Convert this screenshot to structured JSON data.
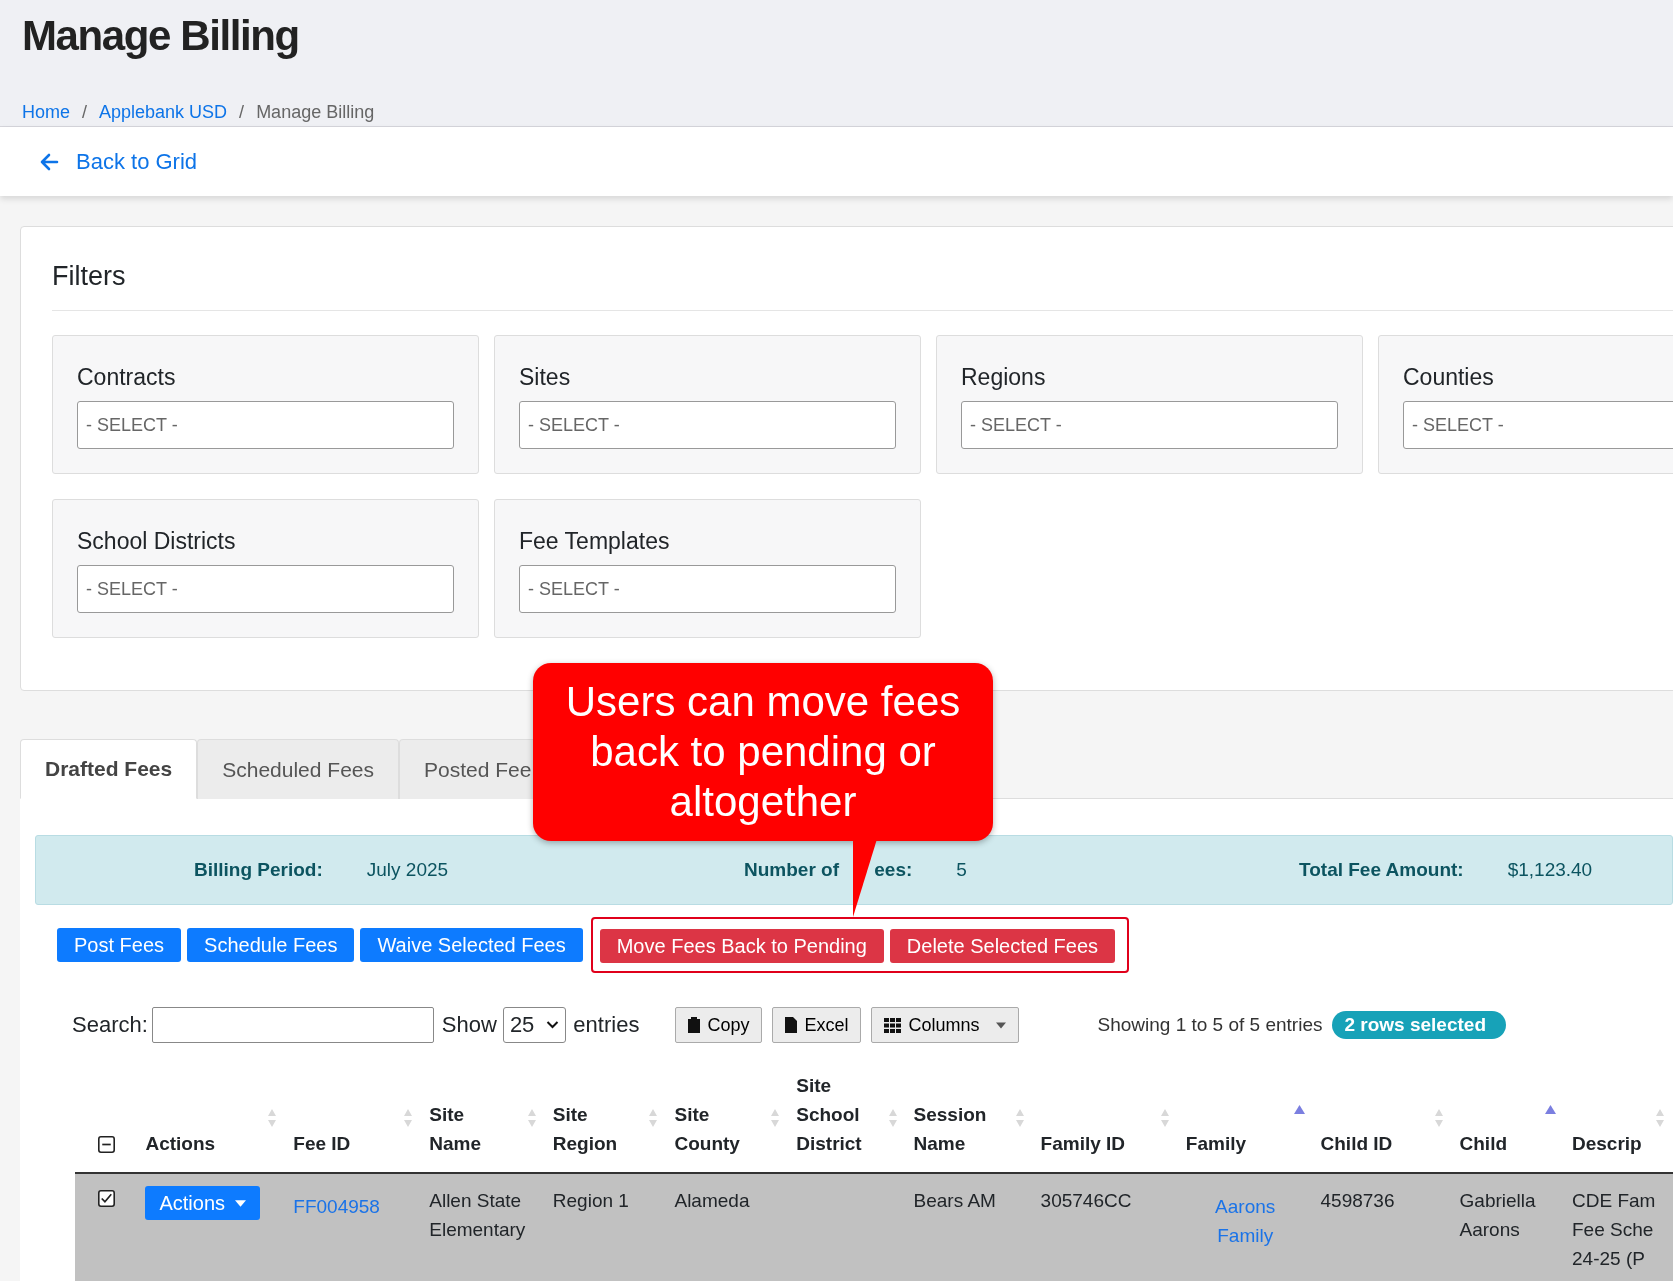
{
  "page": {
    "title": "Manage Billing"
  },
  "breadcrumbs": [
    {
      "label": "Home",
      "link": true
    },
    {
      "separator": "/",
      "label": "Applebank USD",
      "link": true
    },
    {
      "separator": "/",
      "label": "Manage Billing",
      "link": false
    }
  ],
  "back_link": "Back to Grid",
  "filters": {
    "title": "Filters",
    "items": [
      {
        "label": "Contracts",
        "placeholder": "- SELECT -"
      },
      {
        "label": "Sites",
        "placeholder": "- SELECT -"
      },
      {
        "label": "Regions",
        "placeholder": "- SELECT -"
      },
      {
        "label": "Counties",
        "placeholder": "- SELECT -"
      },
      {
        "label": "School Districts",
        "placeholder": "- SELECT -"
      },
      {
        "label": "Fee Templates",
        "placeholder": "- SELECT -"
      }
    ]
  },
  "tabs": [
    {
      "label": "Drafted Fees",
      "selected": true
    },
    {
      "label": "Scheduled Fees",
      "selected": false
    },
    {
      "label": "Posted Fee",
      "selected": false
    }
  ],
  "summary": [
    {
      "label": "Billing Period:",
      "value": "July 2025"
    },
    {
      "label": "Number of",
      "label_rest": "ees:",
      "value": "5"
    },
    {
      "label": "Total Fee Amount:",
      "value": "$1,123.40"
    }
  ],
  "buttons": [
    {
      "label": "Post Fees",
      "kind": "primary"
    },
    {
      "label": "Schedule Fees",
      "kind": "primary"
    },
    {
      "label": "Waive Selected Fees",
      "kind": "primary"
    },
    {
      "label": "Move Fees Back to Pending",
      "kind": "danger"
    },
    {
      "label": "Delete Selected Fees",
      "kind": "danger"
    }
  ],
  "callout": {
    "text": "Users can move fees back to pending or altogether"
  },
  "toolbar": {
    "search_label": "Search:",
    "show_label": "Show",
    "page_size": "25",
    "entries_label": "entries",
    "copy": "Copy",
    "excel": "Excel",
    "columns": "Columns",
    "info": "Showing 1 to 5 of 5 entries",
    "selection_badge": "2 rows selected"
  },
  "table": {
    "select_all_partial": true,
    "columns": [
      {
        "label": "Actions",
        "sorted": false
      },
      {
        "label": "Fee ID",
        "sorted": false
      },
      {
        "label": "Site Name",
        "sorted": false
      },
      {
        "label": "Site Region",
        "sorted": false
      },
      {
        "label": "Site County",
        "sorted": false
      },
      {
        "label": "Site School District",
        "sorted": false
      },
      {
        "label": "Session Name",
        "sorted": false
      },
      {
        "label": "Family ID",
        "sorted": false
      },
      {
        "label": "Family",
        "sorted": true
      },
      {
        "label": "Child ID",
        "sorted": false
      },
      {
        "label": "Child",
        "sorted": true
      },
      {
        "label": "Descrip",
        "sorted": false
      }
    ],
    "rows": [
      {
        "selected": true,
        "action": "Actions",
        "fee_id": "FF004958",
        "site_name": "Allen State Elementary",
        "site_region": "Region 1",
        "site_county": "Alameda",
        "session_name": "Bears AM",
        "family_id": "305746CC",
        "family": "Aarons Family",
        "child_id": "4598736",
        "child": "Gabriella Aarons",
        "description_lines": [
          "CDE Fam",
          "Fee Sche",
          "24-25 (P"
        ]
      }
    ]
  }
}
